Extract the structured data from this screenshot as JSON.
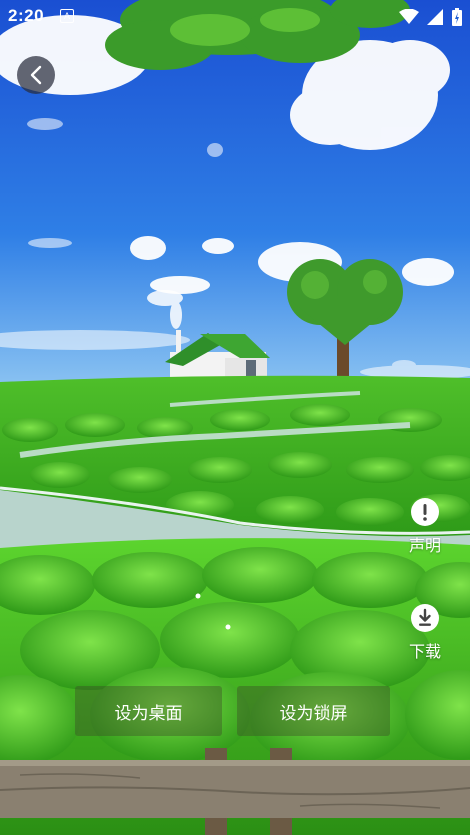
{
  "status_bar": {
    "time": "2:20",
    "notification_icon": "A",
    "icons": [
      "wifi-icon",
      "signal-icon",
      "battery-icon"
    ]
  },
  "back": {
    "icon": "chevron-left-icon"
  },
  "actions": {
    "declare": {
      "label": "声明",
      "icon": "exclamation-icon"
    },
    "download": {
      "label": "下载",
      "icon": "download-icon"
    }
  },
  "buttons": {
    "set_desktop": "设为桌面",
    "set_lockscreen": "设为锁屏"
  },
  "colors": {
    "sky": "#1e5fd6",
    "grass": "#39b21c",
    "overlay_button": "rgba(60,70,40,0.38)"
  }
}
